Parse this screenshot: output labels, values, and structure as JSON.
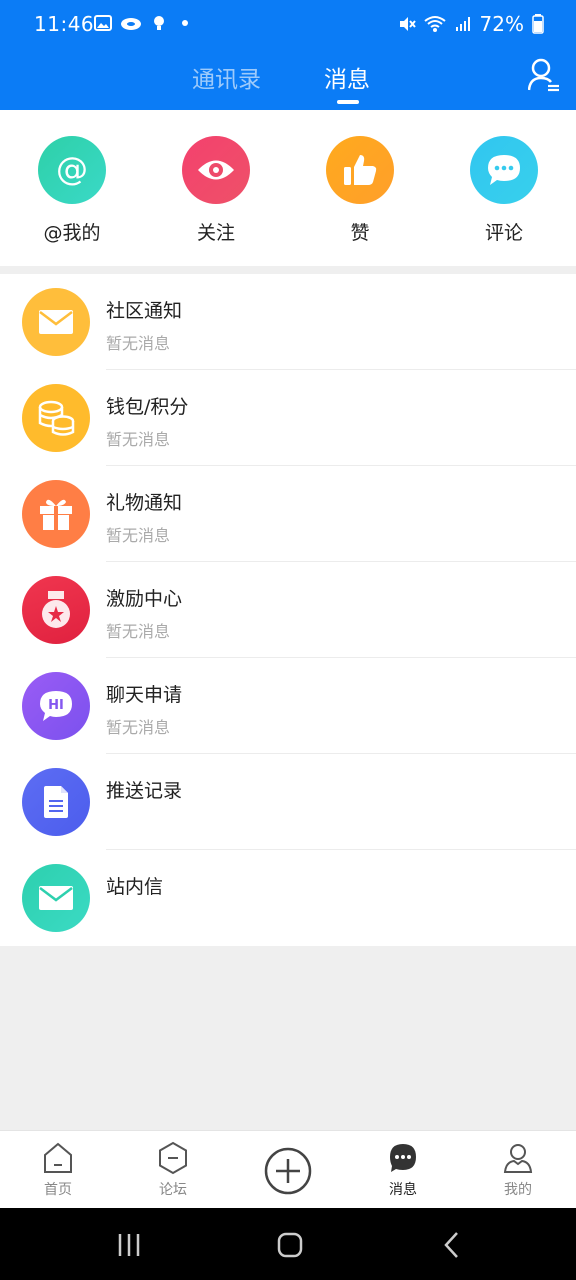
{
  "status": {
    "time": "11:46",
    "battery": "72%"
  },
  "header": {
    "tabs": [
      {
        "label": "通讯录",
        "active": false
      },
      {
        "label": "消息",
        "active": true
      }
    ]
  },
  "quick_actions": [
    {
      "label": "@我的",
      "icon": "at-icon",
      "color": "#2dcfb0"
    },
    {
      "label": "关注",
      "icon": "eye-icon",
      "color": "#f0466b"
    },
    {
      "label": "赞",
      "icon": "thumbs-up-icon",
      "color": "#ffa620"
    },
    {
      "label": "评论",
      "icon": "chat-bubble-icon",
      "color": "#2ec5ee"
    }
  ],
  "list": [
    {
      "title": "社区通知",
      "subtitle": "暂无消息",
      "icon": "envelope-icon",
      "color": "#ffbe3b"
    },
    {
      "title": "钱包/积分",
      "subtitle": "暂无消息",
      "icon": "coins-icon",
      "color": "#ffbb2c"
    },
    {
      "title": "礼物通知",
      "subtitle": "暂无消息",
      "icon": "gift-icon",
      "color": "#ff7e45"
    },
    {
      "title": "激励中心",
      "subtitle": "暂无消息",
      "icon": "medal-icon",
      "color": "#ea2a45"
    },
    {
      "title": "聊天申请",
      "subtitle": "暂无消息",
      "icon": "hi-chat-icon",
      "color": "#8a56f2"
    },
    {
      "title": "推送记录",
      "subtitle": "",
      "icon": "document-icon",
      "color": "#5366f0"
    },
    {
      "title": "站内信",
      "subtitle": "",
      "icon": "mail-icon",
      "color": "#29d3b2"
    }
  ],
  "bottom_nav": [
    {
      "label": "首页",
      "icon": "home-icon",
      "active": false
    },
    {
      "label": "论坛",
      "icon": "forum-icon",
      "active": false
    },
    {
      "label": "",
      "icon": "add-icon",
      "active": false
    },
    {
      "label": "消息",
      "icon": "message-icon",
      "active": true
    },
    {
      "label": "我的",
      "icon": "profile-icon",
      "active": false
    }
  ]
}
